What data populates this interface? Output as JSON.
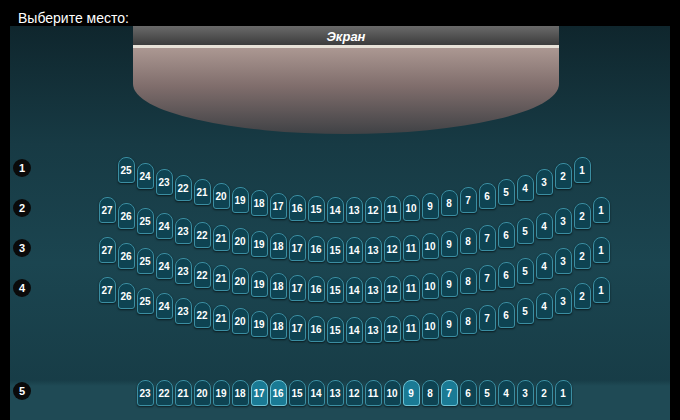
{
  "title": "Выберите место:",
  "screen": {
    "label": "Экран"
  },
  "rows": [
    {
      "label": "1",
      "kind": "curved",
      "seats": [
        {
          "number": "25",
          "highlighted": false
        },
        {
          "number": "24",
          "highlighted": false
        },
        {
          "number": "23",
          "highlighted": false
        },
        {
          "number": "22",
          "highlighted": false
        },
        {
          "number": "21",
          "highlighted": false
        },
        {
          "number": "20",
          "highlighted": false
        },
        {
          "number": "19",
          "highlighted": false
        },
        {
          "number": "18",
          "highlighted": false
        },
        {
          "number": "17",
          "highlighted": false
        },
        {
          "number": "16",
          "highlighted": false
        },
        {
          "number": "15",
          "highlighted": false
        },
        {
          "number": "14",
          "highlighted": false
        },
        {
          "number": "13",
          "highlighted": false
        },
        {
          "number": "12",
          "highlighted": false
        },
        {
          "number": "11",
          "highlighted": false
        },
        {
          "number": "10",
          "highlighted": false
        },
        {
          "number": "9",
          "highlighted": false
        },
        {
          "number": "8",
          "highlighted": false
        },
        {
          "number": "7",
          "highlighted": false
        },
        {
          "number": "6",
          "highlighted": false
        },
        {
          "number": "5",
          "highlighted": false
        },
        {
          "number": "4",
          "highlighted": false
        },
        {
          "number": "3",
          "highlighted": false
        },
        {
          "number": "2",
          "highlighted": false
        },
        {
          "number": "1",
          "highlighted": false
        }
      ]
    },
    {
      "label": "2",
      "kind": "curved",
      "seats": [
        {
          "number": "27",
          "highlighted": false
        },
        {
          "number": "26",
          "highlighted": false
        },
        {
          "number": "25",
          "highlighted": false
        },
        {
          "number": "24",
          "highlighted": false
        },
        {
          "number": "23",
          "highlighted": false
        },
        {
          "number": "22",
          "highlighted": false
        },
        {
          "number": "21",
          "highlighted": false
        },
        {
          "number": "20",
          "highlighted": false
        },
        {
          "number": "19",
          "highlighted": false
        },
        {
          "number": "18",
          "highlighted": false
        },
        {
          "number": "17",
          "highlighted": false
        },
        {
          "number": "16",
          "highlighted": false
        },
        {
          "number": "15",
          "highlighted": false
        },
        {
          "number": "14",
          "highlighted": false
        },
        {
          "number": "13",
          "highlighted": false
        },
        {
          "number": "12",
          "highlighted": false
        },
        {
          "number": "11",
          "highlighted": false
        },
        {
          "number": "10",
          "highlighted": false
        },
        {
          "number": "9",
          "highlighted": false
        },
        {
          "number": "8",
          "highlighted": false
        },
        {
          "number": "7",
          "highlighted": false
        },
        {
          "number": "6",
          "highlighted": false
        },
        {
          "number": "5",
          "highlighted": false
        },
        {
          "number": "4",
          "highlighted": false
        },
        {
          "number": "3",
          "highlighted": false
        },
        {
          "number": "2",
          "highlighted": false
        },
        {
          "number": "1",
          "highlighted": false
        }
      ]
    },
    {
      "label": "3",
      "kind": "curved",
      "seats": [
        {
          "number": "27",
          "highlighted": false
        },
        {
          "number": "26",
          "highlighted": false
        },
        {
          "number": "25",
          "highlighted": false
        },
        {
          "number": "24",
          "highlighted": false
        },
        {
          "number": "23",
          "highlighted": false
        },
        {
          "number": "22",
          "highlighted": false
        },
        {
          "number": "21",
          "highlighted": false
        },
        {
          "number": "20",
          "highlighted": false
        },
        {
          "number": "19",
          "highlighted": false
        },
        {
          "number": "18",
          "highlighted": false
        },
        {
          "number": "17",
          "highlighted": false
        },
        {
          "number": "16",
          "highlighted": false
        },
        {
          "number": "15",
          "highlighted": false
        },
        {
          "number": "14",
          "highlighted": false
        },
        {
          "number": "13",
          "highlighted": false
        },
        {
          "number": "12",
          "highlighted": false
        },
        {
          "number": "11",
          "highlighted": false
        },
        {
          "number": "10",
          "highlighted": false
        },
        {
          "number": "9",
          "highlighted": false
        },
        {
          "number": "8",
          "highlighted": false
        },
        {
          "number": "7",
          "highlighted": false
        },
        {
          "number": "6",
          "highlighted": false
        },
        {
          "number": "5",
          "highlighted": false
        },
        {
          "number": "4",
          "highlighted": false
        },
        {
          "number": "3",
          "highlighted": false
        },
        {
          "number": "2",
          "highlighted": false
        },
        {
          "number": "1",
          "highlighted": false
        }
      ]
    },
    {
      "label": "4",
      "kind": "curved",
      "seats": [
        {
          "number": "27",
          "highlighted": false
        },
        {
          "number": "26",
          "highlighted": false
        },
        {
          "number": "25",
          "highlighted": false
        },
        {
          "number": "24",
          "highlighted": false
        },
        {
          "number": "23",
          "highlighted": false
        },
        {
          "number": "22",
          "highlighted": false
        },
        {
          "number": "21",
          "highlighted": false
        },
        {
          "number": "20",
          "highlighted": false
        },
        {
          "number": "19",
          "highlighted": false
        },
        {
          "number": "18",
          "highlighted": false
        },
        {
          "number": "17",
          "highlighted": false
        },
        {
          "number": "16",
          "highlighted": false
        },
        {
          "number": "15",
          "highlighted": false
        },
        {
          "number": "14",
          "highlighted": false
        },
        {
          "number": "13",
          "highlighted": false
        },
        {
          "number": "12",
          "highlighted": false
        },
        {
          "number": "11",
          "highlighted": false
        },
        {
          "number": "10",
          "highlighted": false
        },
        {
          "number": "9",
          "highlighted": false
        },
        {
          "number": "8",
          "highlighted": false
        },
        {
          "number": "7",
          "highlighted": false
        },
        {
          "number": "6",
          "highlighted": false
        },
        {
          "number": "5",
          "highlighted": false
        },
        {
          "number": "4",
          "highlighted": false
        },
        {
          "number": "3",
          "highlighted": false
        },
        {
          "number": "2",
          "highlighted": false
        },
        {
          "number": "1",
          "highlighted": false
        }
      ]
    },
    {
      "label": "5",
      "kind": "straight",
      "seats": [
        {
          "number": "23",
          "highlighted": false
        },
        {
          "number": "22",
          "highlighted": false
        },
        {
          "number": "21",
          "highlighted": false
        },
        {
          "number": "20",
          "highlighted": false
        },
        {
          "number": "19",
          "highlighted": false
        },
        {
          "number": "18",
          "highlighted": false
        },
        {
          "number": "17",
          "highlighted": true
        },
        {
          "number": "16",
          "highlighted": true
        },
        {
          "number": "15",
          "highlighted": false
        },
        {
          "number": "14",
          "highlighted": false
        },
        {
          "number": "13",
          "highlighted": false
        },
        {
          "number": "12",
          "highlighted": false
        },
        {
          "number": "11",
          "highlighted": false
        },
        {
          "number": "10",
          "highlighted": false
        },
        {
          "number": "9",
          "highlighted": true
        },
        {
          "number": "8",
          "highlighted": false
        },
        {
          "number": "7",
          "highlighted": true
        },
        {
          "number": "6",
          "highlighted": false
        },
        {
          "number": "5",
          "highlighted": false
        },
        {
          "number": "4",
          "highlighted": false
        },
        {
          "number": "3",
          "highlighted": false
        },
        {
          "number": "2",
          "highlighted": false
        },
        {
          "number": "1",
          "highlighted": false
        }
      ]
    }
  ]
}
